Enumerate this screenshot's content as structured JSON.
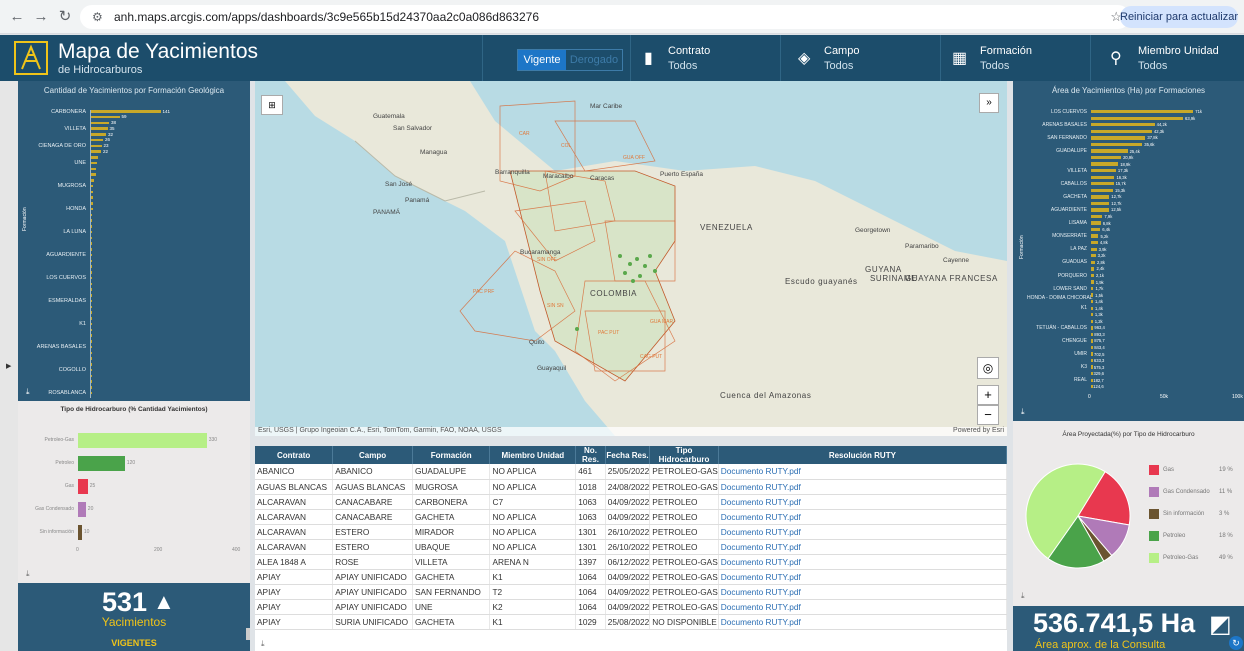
{
  "browser": {
    "url": "anh.maps.arcgis.com/apps/dashboards/3c9e565b15d24370aa2c0a086d863276",
    "reload_label": "Reiniciar para actualizar"
  },
  "header": {
    "title": "Mapa de Yacimientos",
    "subtitle": "de Hidrocarburos",
    "toggle_on": "Vigente",
    "toggle_off": "Derogado",
    "filters": [
      {
        "label": "Contrato",
        "value": "Todos"
      },
      {
        "label": "Campo",
        "value": "Todos"
      },
      {
        "label": "Formación",
        "value": "Todos"
      },
      {
        "label": "Miembro Unidad",
        "value": "Todos"
      }
    ]
  },
  "left_chart": {
    "title": "Cantidad de Yacimientos por Formación Geológica",
    "ylabel": "Formación",
    "labels": [
      "CARBONERA",
      "VILLETA",
      "CIENAGA DE ORO",
      "UNE",
      "MUGROSA",
      "HONDA",
      "LA LUNA",
      "AGUARDIENTE",
      "LOS CUERVOS",
      "ESMERALDAS",
      "K1",
      "ARENAS BASALES",
      "COGOLLO",
      "ROSABLANCA"
    ],
    "values": [
      141,
      59,
      38,
      35,
      32,
      26,
      23,
      22,
      16,
      13,
      11,
      11,
      8,
      6,
      5,
      5,
      5,
      5,
      4,
      4,
      4,
      3,
      3,
      3,
      3,
      3,
      3,
      2,
      2,
      2,
      2,
      2,
      2,
      2,
      2,
      2,
      2,
      1,
      1,
      1,
      1,
      1,
      1,
      1,
      1,
      1,
      1,
      1,
      1,
      1
    ],
    "xticks": [
      "0",
      "150",
      "300"
    ]
  },
  "type_chart": {
    "title": "Tipo de Hidrocarburo (% Cantidad Yacimientos)",
    "categories": [
      "Petroleo-Gas",
      "Petroleo",
      "Gas",
      "Gas Condensado",
      "Sin información"
    ],
    "values": [
      330,
      120,
      25,
      20,
      10
    ],
    "colors": [
      "#b6ef86",
      "#4aa34a",
      "#e8384f",
      "#b07ab8",
      "#6b5430"
    ],
    "xticks": [
      "0",
      "200",
      "400"
    ]
  },
  "kpi_left": {
    "value": "531",
    "label": "Yacimientos",
    "sub": "VIGENTES"
  },
  "map": {
    "attribution": "Esri, USGS | Grupo Ingeoian C.A., Esri, TomTom, Garmin, FAO, NOAA, USGS",
    "powered": "Powered by Esri",
    "places": [
      "Guatemala",
      "San Salvador",
      "Managua",
      "San José",
      "PANAMÁ",
      "Panamá",
      "Barranquilla",
      "Maracaibo",
      "Caracas",
      "Puerto España",
      "VENEZUELA",
      "Bucaramanga",
      "Georgetown",
      "Paramaribo",
      "Cayenne",
      "GUYANA",
      "SURINAME",
      "GUAYANA FRANCESA",
      "Escudo guayanés",
      "COLOMBIA",
      "Quito",
      "Guayaquil",
      "Cuenca del Amazonas",
      "Mar Caribe"
    ],
    "areas": [
      "CAR",
      "COL",
      "GUA OFF",
      "SIN OFF",
      "PAC PRF",
      "SIN SN",
      "PAC PUT",
      "CAG PUT",
      "GUA MAR"
    ]
  },
  "table": {
    "headers": [
      "Contrato",
      "Campo",
      "Formación",
      "Miembro Unidad",
      "No. Res.",
      "Fecha Res.",
      "Tipo Hidrocarburo",
      "Resolución RUTY"
    ],
    "rows": [
      [
        "ABANICO",
        "ABANICO",
        "GUADALUPE",
        "NO APLICA",
        "461",
        "25/05/2022",
        "PETROLEO-GAS",
        "Documento RUTY.pdf"
      ],
      [
        "AGUAS BLANCAS",
        "AGUAS BLANCAS",
        "MUGROSA",
        "NO APLICA",
        "1018",
        "24/08/2022",
        "PETROLEO-GAS",
        "Documento RUTY.pdf"
      ],
      [
        "ALCARAVAN",
        "CANACABARE",
        "CARBONERA",
        "C7",
        "1063",
        "04/09/2022",
        "PETROLEO",
        "Documento RUTY.pdf"
      ],
      [
        "ALCARAVAN",
        "CANACABARE",
        "GACHETA",
        "NO APLICA",
        "1063",
        "04/09/2022",
        "PETROLEO",
        "Documento RUTY.pdf"
      ],
      [
        "ALCARAVAN",
        "ESTERO",
        "MIRADOR",
        "NO APLICA",
        "1301",
        "26/10/2022",
        "PETROLEO",
        "Documento RUTY.pdf"
      ],
      [
        "ALCARAVAN",
        "ESTERO",
        "UBAQUE",
        "NO APLICA",
        "1301",
        "26/10/2022",
        "PETROLEO",
        "Documento RUTY.pdf"
      ],
      [
        "ALEA 1848 A",
        "ROSE",
        "VILLETA",
        "ARENA N",
        "1397",
        "06/12/2022",
        "PETROLEO-GAS",
        "Documento RUTY.pdf"
      ],
      [
        "APIAY",
        "APIAY UNIFICADO",
        "GACHETA",
        "K1",
        "1064",
        "04/09/2022",
        "PETROLEO-GAS",
        "Documento RUTY.pdf"
      ],
      [
        "APIAY",
        "APIAY UNIFICADO",
        "SAN FERNANDO",
        "T2",
        "1064",
        "04/09/2022",
        "PETROLEO-GAS",
        "Documento RUTY.pdf"
      ],
      [
        "APIAY",
        "APIAY UNIFICADO",
        "UNE",
        "K2",
        "1064",
        "04/09/2022",
        "PETROLEO-GAS",
        "Documento RUTY.pdf"
      ],
      [
        "APIAY",
        "SURIA UNIFICADO",
        "GACHETA",
        "K1",
        "1029",
        "25/08/2022",
        "NO DISPONIBLE",
        "Documento RUTY.pdf"
      ]
    ]
  },
  "right_chart": {
    "title": "Área de Yacimientos (Ha) por Formaciones",
    "ylabel": "Formación",
    "labels": [
      "LOS CUERVOS",
      "ARENAS BASALES",
      "SAN FERNANDO",
      "GUADALUPE",
      "VILLETA",
      "CABALLOS",
      "GACHETA",
      "AGUARDIENTE",
      "LISAMA",
      "MONSERRATE",
      "LA PAZ",
      "GUADUAS",
      "PORQUERO",
      "LOWER SAND",
      "HONDA - DOIMA CHICORAL",
      "K1",
      "TETUÁN - CABALLOS",
      "CHENGUE",
      "UMIR",
      "K3",
      "REAL"
    ],
    "values": [
      71000,
      63900,
      44200,
      42300,
      37800,
      35600,
      25400,
      20900,
      18900,
      17300,
      16300,
      15700,
      15300,
      12700,
      12700,
      12500,
      7900,
      6800,
      6400,
      5200,
      4800,
      3900,
      3200,
      2800,
      2400,
      2100,
      1900,
      1700,
      1500,
      1400,
      1400,
      1300,
      1200,
      963,
      893,
      875,
      843,
      702,
      633,
      575,
      329,
      182,
      124
    ],
    "value_labels": [
      "71k",
      "63,9k",
      "44,2k",
      "42,3k",
      "37,8k",
      "35,6k",
      "25,4k",
      "20,9k",
      "18,9k",
      "17,3k",
      "16,3k",
      "15,7k",
      "15,3k",
      "12,7k",
      "12,7k",
      "12,5k",
      "7,9k",
      "6,8k",
      "6,4k",
      "5,2k",
      "4,8k",
      "3,9k",
      "3,2k",
      "2,8k",
      "2,4k",
      "2,1k",
      "1,9k",
      "1,7k",
      "1,5k",
      "1,4k",
      "1,4k",
      "1,3k",
      "1,2k",
      "963,4",
      "893,3",
      "875,7",
      "843,4",
      "702,5",
      "633,3",
      "575,3",
      "329,6",
      "182,7",
      "124,6"
    ],
    "xticks": [
      "0",
      "50k",
      "100k"
    ]
  },
  "pie_chart": {
    "title": "Área Proyectada(%) por Tipo de Hidrocarburo",
    "categories": [
      "Gas",
      "Gas Condensado",
      "Sin información",
      "Petroleo",
      "Petroleo-Gas"
    ],
    "values": [
      19,
      11,
      3,
      18,
      49
    ],
    "labels": [
      "19 %",
      "11 %",
      "3 %",
      "18 %",
      "49 %"
    ],
    "colors": [
      "#e8384f",
      "#b07ab8",
      "#6b5430",
      "#4aa34a",
      "#b6ef86"
    ]
  },
  "kpi_right": {
    "value": "536.741,5 Ha",
    "label": "Área aprox. de la Consulta"
  }
}
